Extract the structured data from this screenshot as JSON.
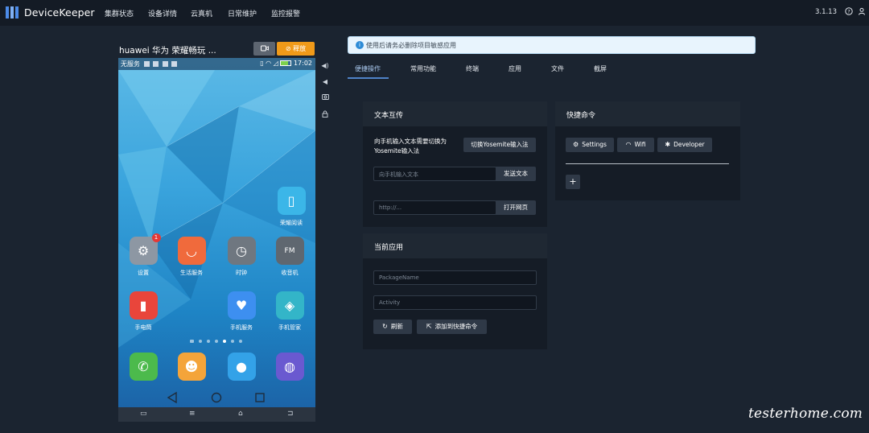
{
  "app": {
    "name": "DeviceKeeper",
    "version": "3.1.13"
  },
  "nav": [
    "集群状态",
    "设备详情",
    "云真机",
    "日常维护",
    "监控报警"
  ],
  "topbar_icons": [
    "help-icon",
    "user-icon"
  ],
  "device": {
    "title": "huawei 华为 荣耀畅玩 ...",
    "camera_icon": "video-icon",
    "release_label": "释放",
    "release_icon": "no-entry-icon",
    "status_left": "无服务",
    "status_time": "17:02",
    "apps": [
      {
        "label": "荣耀阅读",
        "color": "#3bb6e8",
        "glyph": "▯"
      },
      {
        "label": "设置",
        "color": "#8d97a3",
        "glyph": "⚙",
        "badge": "1"
      },
      {
        "label": "生活服务",
        "color": "#f06a3c",
        "glyph": "◡"
      },
      {
        "label": "时钟",
        "color": "#6f7780",
        "glyph": "◷"
      },
      {
        "label": "收音机",
        "color": "#5f6770",
        "glyph": "FM"
      },
      {
        "label": "手电筒",
        "color": "#e9453b",
        "glyph": "▮"
      },
      {
        "label": "手机服务",
        "color": "#3d8ff0",
        "glyph": "♥"
      },
      {
        "label": "手机管家",
        "color": "#33b5c8",
        "glyph": "◈"
      },
      {
        "label": "",
        "color": "#4cba4c",
        "glyph": "✆"
      },
      {
        "label": "",
        "color": "#f4a43a",
        "glyph": "☻"
      },
      {
        "label": "",
        "color": "#33a2e8",
        "glyph": "●"
      },
      {
        "label": "",
        "color": "#6a59d0",
        "glyph": "◍"
      }
    ],
    "navbar": [
      "▭",
      "≡",
      "⌂",
      "⊐"
    ]
  },
  "side_tools": [
    "volume-up-icon",
    "volume-down-icon",
    "camera-icon",
    "lock-icon"
  ],
  "alert": {
    "text": "使用后请务必删除项目敏感应用"
  },
  "tabs": [
    {
      "label": "便捷操作",
      "active": true
    },
    {
      "label": "常用功能"
    },
    {
      "label": "终端"
    },
    {
      "label": "应用"
    },
    {
      "label": "文件"
    },
    {
      "label": "截屏"
    }
  ],
  "text_card": {
    "title": "文本互传",
    "hint_line1": "向手机输入文本需要切换为",
    "hint_line2": "Yosemite输入法",
    "switch_button": "切换Yosemite输入法",
    "text_placeholder": "向手机输入文本",
    "send_button": "发送文本",
    "url_placeholder": "http://...",
    "open_button": "打开网页"
  },
  "quick_card": {
    "title": "快捷命令",
    "commands": [
      {
        "label": "Settings",
        "icon": "gear-icon"
      },
      {
        "label": "Wifi",
        "icon": "wifi-icon"
      },
      {
        "label": "Developer",
        "icon": "bug-icon"
      }
    ],
    "add_label": "+"
  },
  "current_app_card": {
    "title": "当前应用",
    "package_placeholder": "PackageName",
    "activity_placeholder": "Activity",
    "refresh_button": "刷新",
    "add_shortcut_button": "添加到快捷命令"
  },
  "watermark": "testerhome.com"
}
